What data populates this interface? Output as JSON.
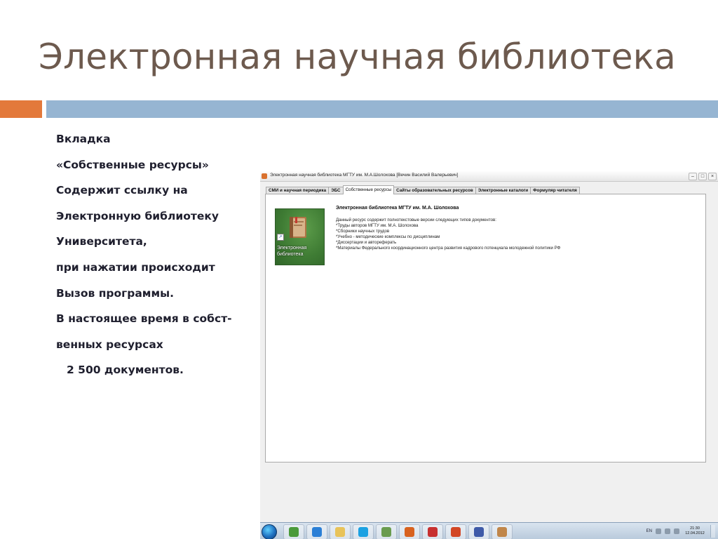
{
  "slide": {
    "title": "Электронная научная библиотека",
    "bullets": [
      "Вкладка",
      "«Собственные ресурсы»",
      "Содержит ссылку на",
      "Электронную библиотеку",
      "Университета,",
      "при нажатии происходит",
      "Вызов программы.",
      "В настоящее время в собст-",
      "венных ресурсах",
      "2 500 документов."
    ],
    "accent_color": "#e3793b",
    "bar_color": "#96b5d2",
    "title_color": "#6d5a4e"
  },
  "window": {
    "title": "Электронная научная библиотека МГТУ им. М.А.Шолохова  [Вечин Василий Валерьевич]",
    "controls": {
      "minimize": "–",
      "maximize": "□",
      "close": "×"
    },
    "app_icon": "library-app-icon",
    "tabs": [
      {
        "label": "СМИ и научная периодика",
        "active": false
      },
      {
        "label": "ЭБС",
        "active": false
      },
      {
        "label": "Собственные ресурсы",
        "active": true
      },
      {
        "label": "Сайты образовательных ресурсов",
        "active": false
      },
      {
        "label": "Электронные каталоги",
        "active": false
      },
      {
        "label": "Формуляр читателя",
        "active": false
      }
    ],
    "resource": {
      "icon": "book-icon",
      "icon_label": "Электронная библиотека",
      "heading": "Электронная библиотека МГТУ  им. М.А. Шолохова",
      "description": [
        "Данный ресурс содержит полнотекстовые версии следующих типов документов:",
        "*Труды авторов МГТУ им. М.А. Шолохова",
        "*Сборники научных трудов",
        "*Учебно - методические комплексы по дисциплинам",
        "*Диссертации и автореферать",
        "*Материалы Федерального координационного центра развития кадрового потенциала молодежной политики РФ"
      ]
    }
  },
  "taskbar": {
    "start_icon": "windows-start-icon",
    "buttons": [
      {
        "icon": "chrome-icon",
        "color": "#4a9a3a"
      },
      {
        "icon": "ie-icon",
        "color": "#2b7fd6"
      },
      {
        "icon": "folder-icon",
        "color": "#e8c35a"
      },
      {
        "icon": "skype-icon",
        "color": "#1ba1e2"
      },
      {
        "icon": "app-icon",
        "color": "#6a9c4f"
      },
      {
        "icon": "firefox-icon",
        "color": "#d8621f"
      },
      {
        "icon": "flashcard-icon",
        "color": "#c73030"
      },
      {
        "icon": "powerpoint-icon",
        "color": "#d24726"
      },
      {
        "icon": "people-icon",
        "color": "#3e5aa8"
      },
      {
        "icon": "library-icon",
        "color": "#c0864a"
      }
    ],
    "lang": "EN",
    "time": "21:30",
    "date": "12.04.2012"
  }
}
